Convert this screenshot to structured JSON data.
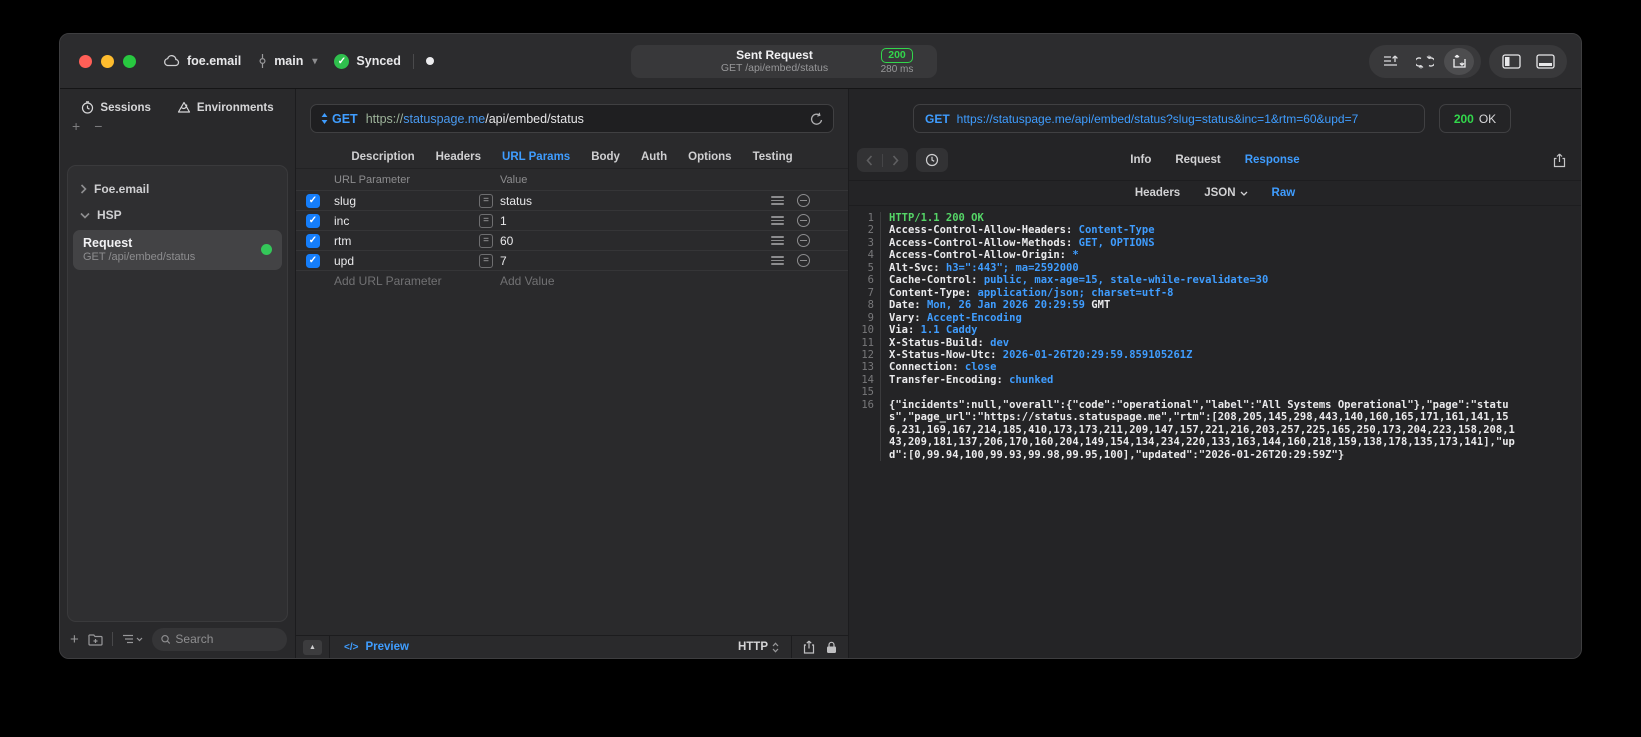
{
  "titlebar": {
    "project": "foe.email",
    "branch": "main",
    "sync_status": "Synced",
    "request_summary": {
      "title": "Sent Request",
      "subtitle": "GET /api/embed/status",
      "status_code": "200",
      "duration": "280 ms"
    }
  },
  "sidebar": {
    "tabs": {
      "sessions": "Sessions",
      "environments": "Environments"
    },
    "tree": {
      "group1": "Foe.email",
      "group2": "HSP"
    },
    "selected_request": {
      "name": "Request",
      "summary": "GET /api/embed/status"
    },
    "search_placeholder": "Search"
  },
  "request_panel": {
    "method": "GET",
    "url": {
      "scheme": "https://",
      "host": "statuspage.me",
      "path": "/api/embed/status"
    },
    "tabs": [
      "Description",
      "Headers",
      "URL Params",
      "Body",
      "Auth",
      "Options",
      "Testing"
    ],
    "active_tab": "URL Params",
    "params": {
      "col_name": "URL Parameter",
      "col_value": "Value",
      "rows": [
        {
          "name": "slug",
          "value": "status",
          "enabled": true
        },
        {
          "name": "inc",
          "value": "1",
          "enabled": true
        },
        {
          "name": "rtm",
          "value": "60",
          "enabled": true
        },
        {
          "name": "upd",
          "value": "7",
          "enabled": true
        }
      ],
      "add_name": "Add URL Parameter",
      "add_value": "Add Value"
    },
    "footer": {
      "code_glyph": "</>",
      "preview": "Preview",
      "protocol": "HTTP"
    }
  },
  "response_panel": {
    "request_line": {
      "method": "GET",
      "url": "https://statuspage.me/api/embed/status?slug=status&inc=1&rtm=60&upd=7"
    },
    "status": {
      "code": "200",
      "text": "OK"
    },
    "tabs": [
      "Info",
      "Request",
      "Response"
    ],
    "active_tab": "Response",
    "subtabs": [
      "Headers",
      "JSON",
      "Raw"
    ],
    "active_subtab": "Raw",
    "code_lines": [
      {
        "n": "1",
        "parts": [
          [
            "g",
            "HTTP/1.1 200 OK"
          ]
        ]
      },
      {
        "n": "2",
        "parts": [
          [
            "w",
            "Access-Control-Allow-Headers: "
          ],
          [
            "b",
            "Content-Type"
          ]
        ]
      },
      {
        "n": "3",
        "parts": [
          [
            "w",
            "Access-Control-Allow-Methods: "
          ],
          [
            "b",
            "GET, OPTIONS"
          ]
        ]
      },
      {
        "n": "4",
        "parts": [
          [
            "w",
            "Access-Control-Allow-Origin: "
          ],
          [
            "b",
            "*"
          ]
        ]
      },
      {
        "n": "5",
        "parts": [
          [
            "w",
            "Alt-Svc: "
          ],
          [
            "b",
            "h3=\":443\"; ma=2592000"
          ]
        ]
      },
      {
        "n": "6",
        "parts": [
          [
            "w",
            "Cache-Control: "
          ],
          [
            "b",
            "public, max-age=15, stale-while-revalidate=30"
          ]
        ]
      },
      {
        "n": "7",
        "parts": [
          [
            "w",
            "Content-Type: "
          ],
          [
            "b",
            "application/json; charset=utf-8"
          ]
        ]
      },
      {
        "n": "8",
        "parts": [
          [
            "w",
            "Date: "
          ],
          [
            "b",
            "Mon, 26 Jan 2026 20:29:59"
          ],
          [
            "w",
            " GMT"
          ]
        ]
      },
      {
        "n": "9",
        "parts": [
          [
            "w",
            "Vary: "
          ],
          [
            "b",
            "Accept-Encoding"
          ]
        ]
      },
      {
        "n": "10",
        "parts": [
          [
            "w",
            "Via: "
          ],
          [
            "b",
            "1.1 Caddy"
          ]
        ]
      },
      {
        "n": "11",
        "parts": [
          [
            "w",
            "X-Status-Build: "
          ],
          [
            "b",
            "dev"
          ]
        ]
      },
      {
        "n": "12",
        "parts": [
          [
            "w",
            "X-Status-Now-Utc: "
          ],
          [
            "b",
            "2026-01-26T20:29:59.859105261Z"
          ]
        ]
      },
      {
        "n": "13",
        "parts": [
          [
            "w",
            "Connection: "
          ],
          [
            "b",
            "close"
          ]
        ]
      },
      {
        "n": "14",
        "parts": [
          [
            "w",
            "Transfer-Encoding: "
          ],
          [
            "b",
            "chunked"
          ]
        ]
      },
      {
        "n": "15",
        "parts": []
      },
      {
        "n": "16",
        "parts": [
          [
            "w",
            "{\"incidents\":null,\"overall\":{\"code\":\"operational\",\"label\":\"All Systems Operational\"},\"page\":\"status\",\"page_url\":\"https://status.statuspage.me\",\"rtm\":[208,205,145,298,443,140,160,165,171,161,141,156,231,169,167,214,185,410,173,173,211,209,147,157,221,216,203,257,225,165,250,173,204,223,158,208,143,209,181,137,206,170,160,204,149,154,134,234,220,133,163,144,160,218,159,138,178,135,173,141],\"upd\":[0,99.94,100,99.93,99.98,99.95,100],\"updated\":\"2026-01-26T20:29:59Z\"}"
          ]
        ]
      }
    ]
  },
  "colors": {
    "accent_blue": "#3f9dff",
    "success_green": "#32d74b",
    "checkbox_blue": "#157efb",
    "window_bg": "#29292b"
  }
}
